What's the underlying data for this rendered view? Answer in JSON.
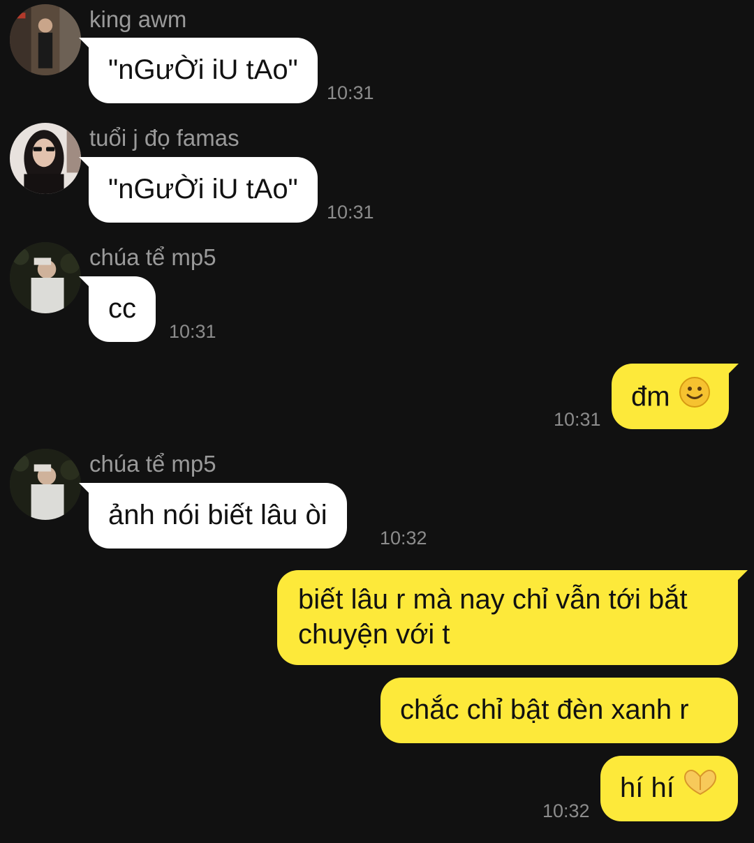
{
  "messages": [
    {
      "sender": "king awm",
      "text": "\"nGưỜi iU tAo\"",
      "time": "10:31"
    },
    {
      "sender": "tuổi j đọ famas",
      "text": "\"nGưỜi iU tAo\"",
      "time": "10:31"
    },
    {
      "sender": "chúa tể mp5",
      "text": "cc",
      "time": "10:31"
    },
    {
      "text": "đm",
      "emoji": "slightly-smiling-face-icon",
      "time": "10:31"
    },
    {
      "sender": "chúa tể mp5",
      "text": "ảnh nói biết lâu òi",
      "time": "10:32"
    },
    {
      "text": "biết lâu r mà nay chỉ vẫn tới bắt chuyện với t"
    },
    {
      "text": "chắc chỉ bật đèn xanh r"
    },
    {
      "text": "hí hí",
      "emoji": "heart-hands-icon",
      "time": "10:32"
    }
  ],
  "colors": {
    "background": "#111111",
    "incoming_bubble": "#ffffff",
    "outgoing_bubble": "#fde93a",
    "sender_name": "#9a9a9a",
    "timestamp": "#8c8c8c"
  }
}
